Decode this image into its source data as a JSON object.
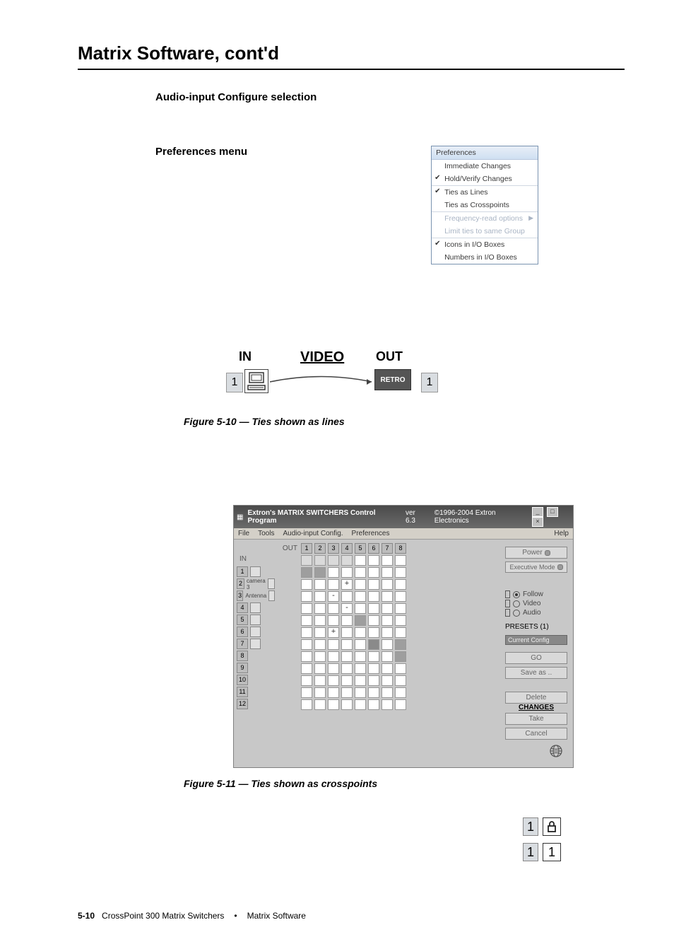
{
  "page": {
    "title": "Matrix Software, cont'd",
    "section1": "Audio-input Configure selection",
    "section2": "Preferences menu",
    "footer_page": "5-10",
    "footer_book": "CrossPoint 300 Matrix Switchers",
    "footer_chapter": "Matrix Software"
  },
  "prefs_menu": {
    "title": "Preferences",
    "items_a": [
      {
        "label": "Immediate Changes",
        "checked": false
      },
      {
        "label": "Hold/Verify Changes",
        "checked": true
      }
    ],
    "items_b": [
      {
        "label": "Ties as Lines",
        "checked": true
      },
      {
        "label": "Ties as Crosspoints",
        "checked": false
      }
    ],
    "items_c": [
      {
        "label": "Frequency-read options",
        "disabled": true,
        "submenu": true
      },
      {
        "label": "Limit ties to same Group",
        "disabled": true
      }
    ],
    "items_d": [
      {
        "label": "Icons in I/O Boxes",
        "checked": true
      },
      {
        "label": "Numbers in I/O Boxes",
        "checked": false
      }
    ]
  },
  "fig510": {
    "in": "IN",
    "video": "VIDEO",
    "out": "OUT",
    "one_left": "1",
    "one_right": "1",
    "retro": "RETRO",
    "caption": "Figure 5-10 — Ties shown as lines"
  },
  "matrix": {
    "title_left": "Extron's MATRIX SWITCHERS Control Program",
    "version": "ver 6.3",
    "copyright": "©1996-2004 Extron Electronics",
    "menubar": [
      "File",
      "Tools",
      "Audio-input Config.",
      "Preferences",
      "Help"
    ],
    "out_label": "OUT",
    "in_label": "IN",
    "outputs": [
      "1",
      "2",
      "3",
      "4",
      "5",
      "6",
      "7",
      "8"
    ],
    "input_rows": [
      {
        "n": "1",
        "name": "",
        "icon": true
      },
      {
        "n": "2",
        "name": "camera 3",
        "icon": true
      },
      {
        "n": "3",
        "name": "Antenna",
        "icon": true
      },
      {
        "n": "4",
        "name": "",
        "icon": true
      },
      {
        "n": "5",
        "name": "",
        "icon": true
      },
      {
        "n": "6",
        "name": "",
        "icon": true
      },
      {
        "n": "7",
        "name": "",
        "icon": true
      },
      {
        "n": "8",
        "name": "",
        "icon": false
      },
      {
        "n": "9",
        "name": "",
        "icon": false
      },
      {
        "n": "10",
        "name": "",
        "icon": false
      },
      {
        "n": "11",
        "name": "",
        "icon": false
      },
      {
        "n": "12",
        "name": "",
        "icon": false
      }
    ],
    "ties": {
      "1": {
        "1": "fill",
        "2": "fill"
      },
      "2": {
        "4": "+"
      },
      "3": {
        "3": "-"
      },
      "4": {
        "4": "-"
      },
      "5": {
        "5": "fill"
      },
      "6": {
        "3": "+"
      },
      "7": {
        "6": "fill-d",
        "8": "fill"
      },
      "8": {
        "8": "fill"
      }
    },
    "right": {
      "power": "Power",
      "exec": "Executive Mode",
      "follow": "Follow",
      "video": "Video",
      "audio": "Audio",
      "presets": "PRESETS (1)",
      "combo": "Current Config",
      "go": "GO",
      "saveas": "Save as ..",
      "delete": "Delete",
      "changes": "CHANGES",
      "take": "Take",
      "cancel": "Cancel"
    },
    "caption": "Figure 5-11 — Ties shown as crosspoints"
  },
  "br": {
    "one_a": "1",
    "one_b": "1",
    "one_c": "1"
  }
}
